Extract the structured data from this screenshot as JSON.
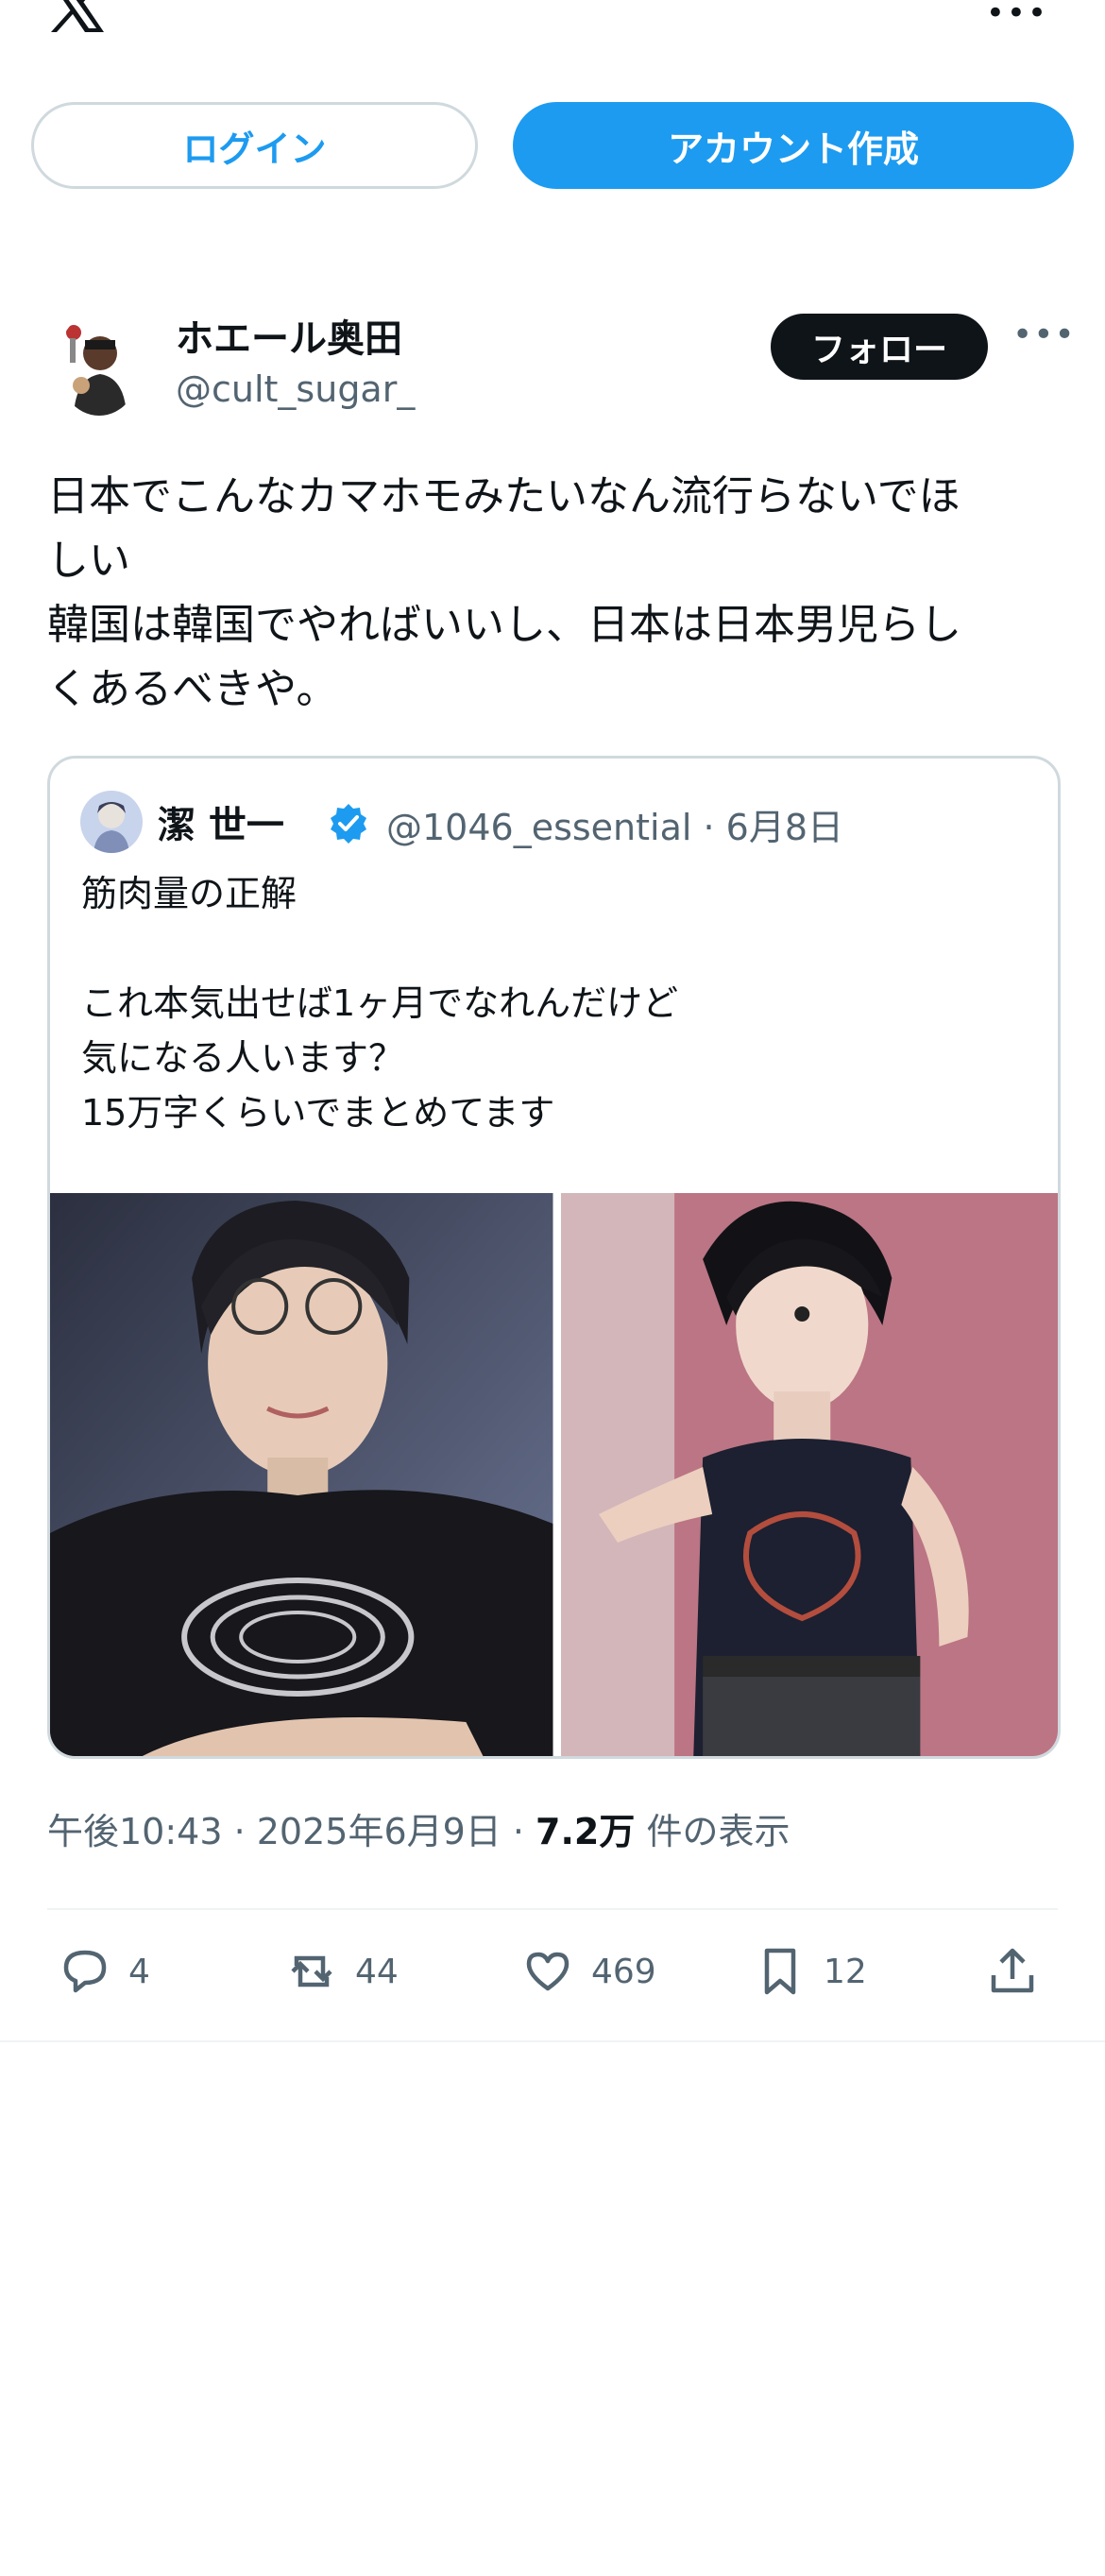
{
  "colors": {
    "accent": "#1d9bf0",
    "text": "#0f1419",
    "muted": "#536471",
    "border": "#cfd9de"
  },
  "auth": {
    "login_label": "ログイン",
    "signup_label": "アカウント作成"
  },
  "author": {
    "name": "ホエール奥田",
    "handle": "@cult_sugar_",
    "follow_label": "フォロー"
  },
  "tweet": {
    "lines": [
      "日本でこんなカマホモみたいなん流行らないでほ",
      "しい",
      "韓国は韓国でやればいいし、日本は日本男児らし",
      "くあるべきや。"
    ],
    "timestamp": "午後10:43 · 2025年6月9日 · ",
    "views_count": "7.2万",
    "views_label": " 件の表示"
  },
  "quote": {
    "name": "潔 世一",
    "handle_date": "@1046_essential · 6月8日",
    "lines": [
      "筋肉量の正解",
      "",
      "これ本気出せば1ヶ月でなれんだけど",
      "気になる人います？",
      "15万字くらいでまとめてます"
    ]
  },
  "actions": {
    "replies": "4",
    "reposts": "44",
    "likes": "469",
    "bookmarks": "12"
  },
  "icons": [
    "x-logo-icon",
    "more-icon",
    "verified-icon",
    "reply-icon",
    "repost-icon",
    "like-icon",
    "bookmark-icon",
    "share-icon"
  ]
}
